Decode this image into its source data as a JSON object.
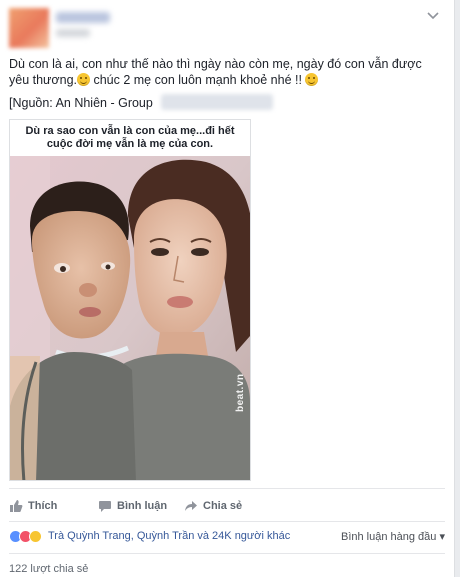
{
  "post": {
    "text_line1": "Dù con là ai, con như thế nào thì ngày nào còn mẹ, ngày đó con vẫn được",
    "text_line2a": "yêu thương.",
    "text_line2b": " chúc 2 mẹ con luôn mạnh khoẻ nhé !!",
    "source_label": "[Nguồn: An Nhiên - Group",
    "image_caption": "Dù ra sao con vẫn là con của mẹ...đi hết cuộc đời mẹ vẫn là mẹ của con.",
    "image_watermark": "beat.vn"
  },
  "actions": {
    "like": "Thích",
    "comment": "Bình luận",
    "share": "Chia sẻ"
  },
  "reactions": {
    "summary": "Trà Quỳnh Trang, Quỳnh Trần và 24K người khác",
    "sort_label": "Bình luận hàng đầu"
  },
  "shares": {
    "count_label": "122 lượt chia sẻ"
  },
  "colors": {
    "link": "#365899",
    "action_text": "#606770",
    "like_reaction": "#5890ff",
    "love_reaction": "#f25268",
    "haha_reaction": "#f7c531"
  },
  "icons": {
    "menu": "chevron-down-icon",
    "like": "thumbs-up-icon",
    "comment": "speech-bubble-icon",
    "share": "share-arrow-icon"
  }
}
